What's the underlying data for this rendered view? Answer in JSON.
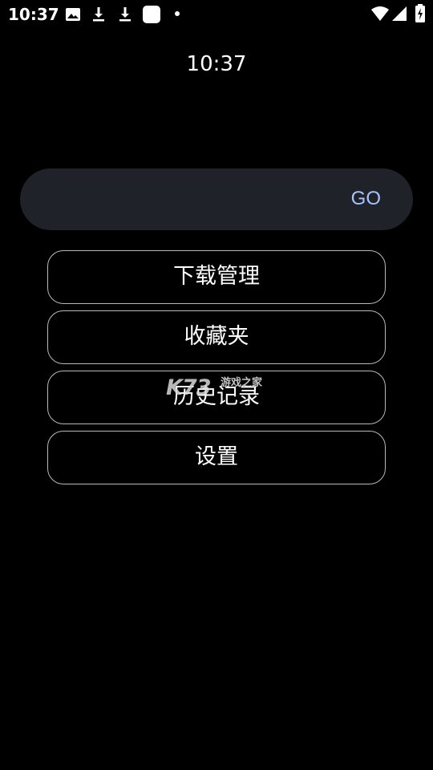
{
  "status_bar": {
    "time": "10:37",
    "left_icons": [
      "image-icon",
      "download-icon",
      "download-icon",
      "app-square-icon",
      "dot-icon"
    ],
    "right_icons": [
      "wifi-icon",
      "cell-signal-icon",
      "battery-charging-icon"
    ]
  },
  "clock": {
    "time": "10:37"
  },
  "search": {
    "value": "",
    "placeholder": "",
    "go_label": "GO"
  },
  "menu": {
    "items": [
      {
        "label": "下载管理"
      },
      {
        "label": "收藏夹"
      },
      {
        "label": "历史记录"
      },
      {
        "label": "设置"
      }
    ]
  },
  "watermark": {
    "logo": "K73",
    "text": "游戏之家"
  },
  "colors": {
    "background": "#000000",
    "search_bg": "#1f2228",
    "go_accent": "#a6c2ff",
    "button_border": "#b9b9b9"
  }
}
